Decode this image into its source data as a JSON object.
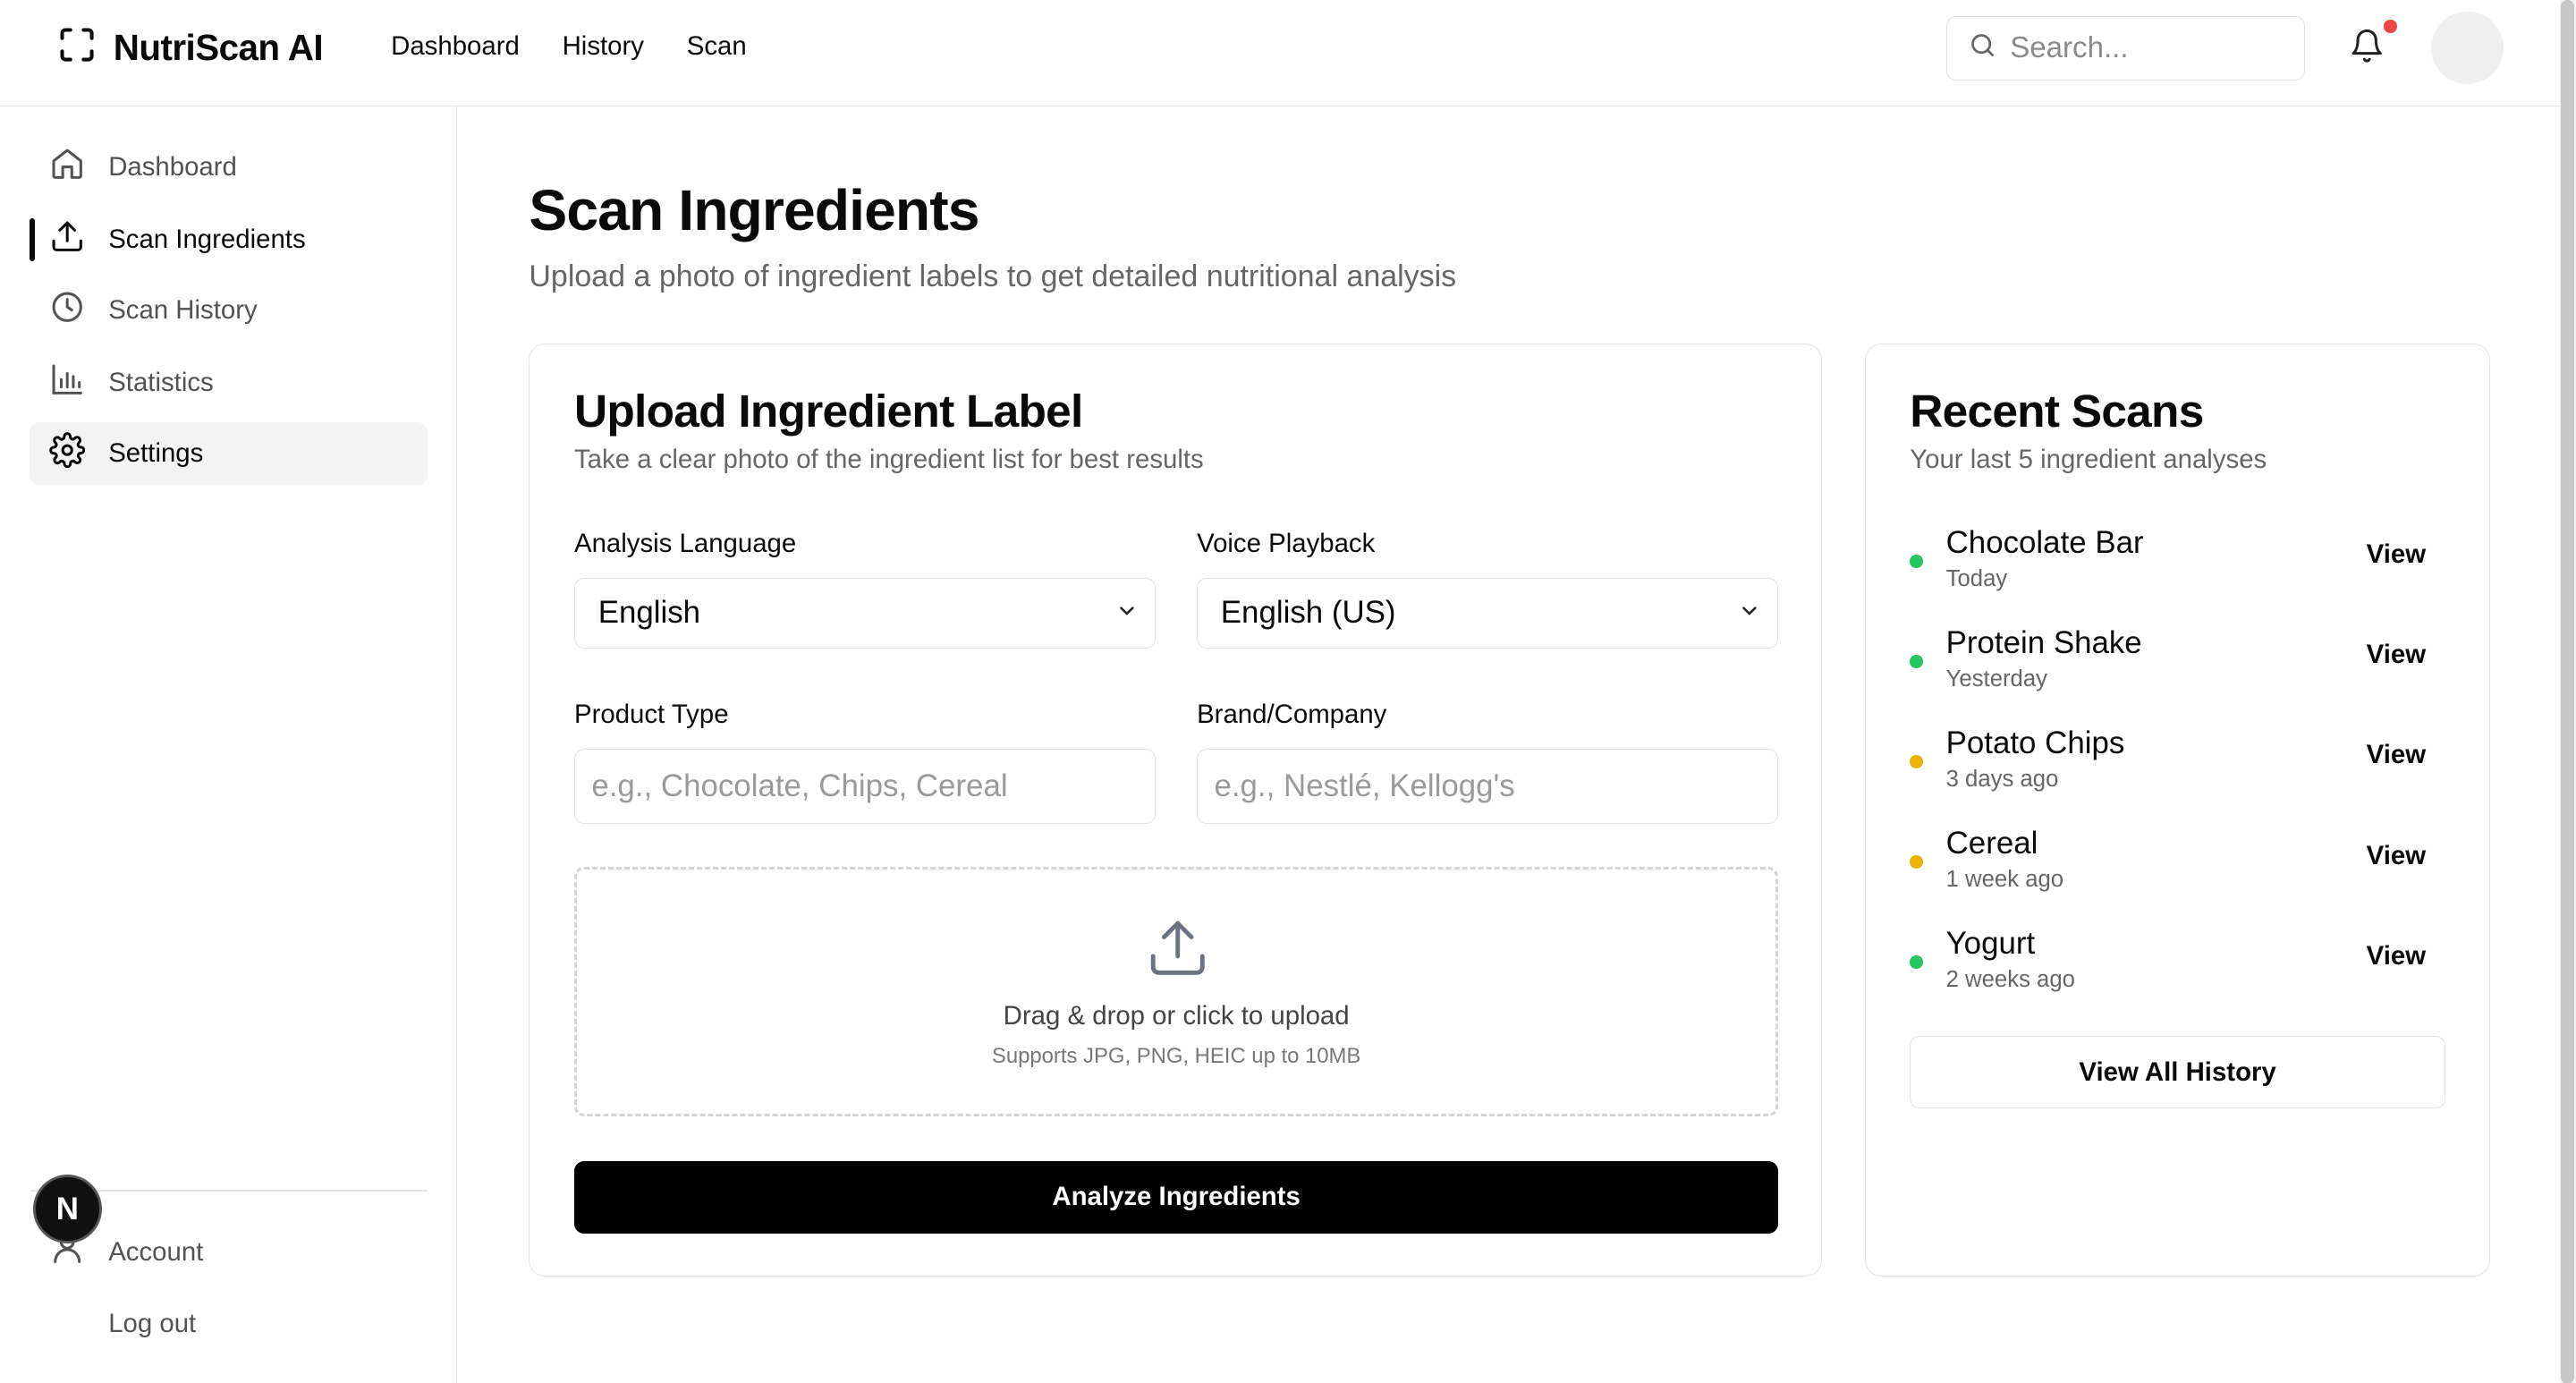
{
  "app": {
    "name": "NutriScan AI"
  },
  "topnav": {
    "items": [
      "Dashboard",
      "History",
      "Scan"
    ]
  },
  "search": {
    "placeholder": "Search..."
  },
  "sidebar": {
    "items": [
      {
        "label": "Dashboard",
        "icon": "home-icon"
      },
      {
        "label": "Scan Ingredients",
        "icon": "upload-icon"
      },
      {
        "label": "Scan History",
        "icon": "clock-icon"
      },
      {
        "label": "Statistics",
        "icon": "bar-chart-icon"
      },
      {
        "label": "Settings",
        "icon": "gear-icon"
      }
    ],
    "bottom": [
      {
        "label": "Account",
        "icon": "user-icon"
      },
      {
        "label": "Log out"
      }
    ],
    "badge_letter": "N"
  },
  "page": {
    "title": "Scan Ingredients",
    "subtitle": "Upload a photo of ingredient labels to get detailed nutritional analysis"
  },
  "upload": {
    "title": "Upload Ingredient Label",
    "subtitle": "Take a clear photo of the ingredient list for best results",
    "analysis_language_label": "Analysis Language",
    "analysis_language_value": "English",
    "voice_label": "Voice Playback",
    "voice_value": "English (US)",
    "product_type_label": "Product Type",
    "product_type_placeholder": "e.g., Chocolate, Chips, Cereal",
    "brand_label": "Brand/Company",
    "brand_placeholder": "e.g., Nestlé, Kellogg's",
    "dropzone_title": "Drag & drop or click to upload",
    "dropzone_sub": "Supports JPG, PNG, HEIC up to 10MB",
    "analyze_label": "Analyze Ingredients"
  },
  "recent": {
    "title": "Recent Scans",
    "subtitle": "Your last 5 ingredient analyses",
    "view_label": "View",
    "view_all_label": "View All History",
    "items": [
      {
        "name": "Chocolate Bar",
        "when": "Today",
        "status_color": "#22c55e"
      },
      {
        "name": "Protein Shake",
        "when": "Yesterday",
        "status_color": "#22c55e"
      },
      {
        "name": "Potato Chips",
        "when": "3 days ago",
        "status_color": "#eab308"
      },
      {
        "name": "Cereal",
        "when": "1 week ago",
        "status_color": "#eab308"
      },
      {
        "name": "Yogurt",
        "when": "2 weeks ago",
        "status_color": "#22c55e"
      }
    ]
  },
  "colors": {
    "notification_dot": "#ef4444",
    "primary_button": "#000000"
  }
}
